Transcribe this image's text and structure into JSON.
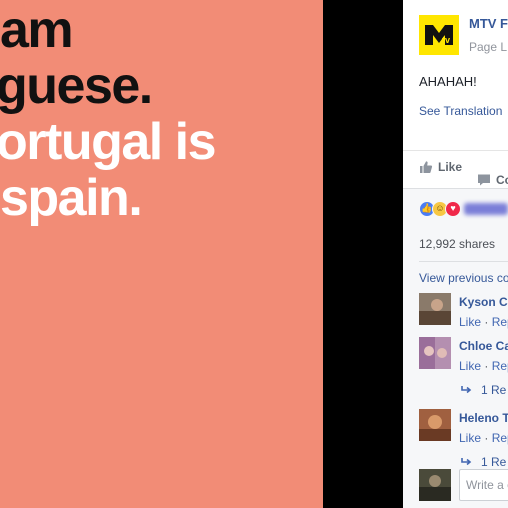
{
  "photo": {
    "lines": [
      "am",
      "guese.",
      "ortugal is",
      "spain."
    ],
    "background": "#f28c76"
  },
  "post": {
    "page_name": "MTV F",
    "page_sub": "Page L",
    "text": "AHAHAH!",
    "see_translation": "See Translation",
    "like_label": "Like",
    "comment_label": "Co"
  },
  "feedback": {
    "reactions": [
      "like-icon",
      "haha-icon",
      "love-icon"
    ],
    "shares": "12,992 shares",
    "view_previous": "View previous co",
    "comments": [
      {
        "name": "Kyson C",
        "like": "Like",
        "reply": "Rep"
      },
      {
        "name": "Chloe Ca",
        "like": "Like",
        "reply": "Rep",
        "replies": "1 Re"
      },
      {
        "name": "Heleno T",
        "like": "Like",
        "reply": "Rep",
        "replies": "1 Re"
      }
    ],
    "write_comment_placeholder": "Write a c"
  },
  "colors": {
    "link": "#365899",
    "logo_bg": "#ffe600",
    "reaction_like": "#4a7df5",
    "reaction_haha": "#f7c744",
    "reaction_love": "#f0284a"
  }
}
